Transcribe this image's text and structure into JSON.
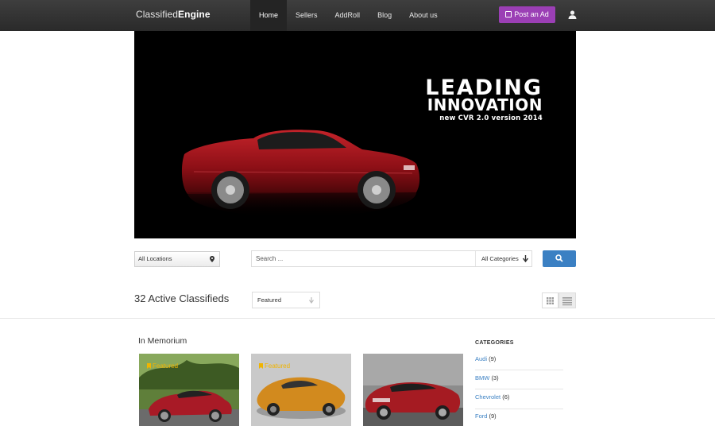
{
  "brand": {
    "part1": "Classified",
    "part2": "Engine"
  },
  "nav": {
    "items": [
      "Home",
      "Sellers",
      "AddRoll",
      "Blog",
      "About us"
    ],
    "active": "Home",
    "post_ad_label": "Post an Ad"
  },
  "hero": {
    "line1": "LEADING",
    "line2": "INNOVATION",
    "line3": "new CVR 2.0 version 2014"
  },
  "search": {
    "location": "All Locations",
    "placeholder": "Search ...",
    "category": "All Categories"
  },
  "listing": {
    "count_title": "32 Active Classifieds",
    "sort": "Featured"
  },
  "section": {
    "title": "In Memorium",
    "cards": [
      {
        "badge": "Featured"
      },
      {
        "badge": "Featured"
      },
      {
        "badge": ""
      }
    ]
  },
  "categories": {
    "heading": "CATEGORIES",
    "items": [
      {
        "name": "Audi",
        "count": "(9)"
      },
      {
        "name": "BMW",
        "count": "(3)"
      },
      {
        "name": "Chevrolet",
        "count": "(6)"
      },
      {
        "name": "Ford",
        "count": "(9)"
      }
    ]
  },
  "colors": {
    "accent_purple": "#9b3fb5",
    "accent_blue": "#3b80c3",
    "featured_yellow": "#f0b400"
  },
  "icons": {
    "post_ad": "edit-icon",
    "account": "user-icon",
    "location": "map-pin-icon",
    "category": "arrow-down-icon",
    "search": "search-icon",
    "grid_view": "grid-icon",
    "list_view": "list-icon",
    "featured": "bookmark-icon"
  }
}
